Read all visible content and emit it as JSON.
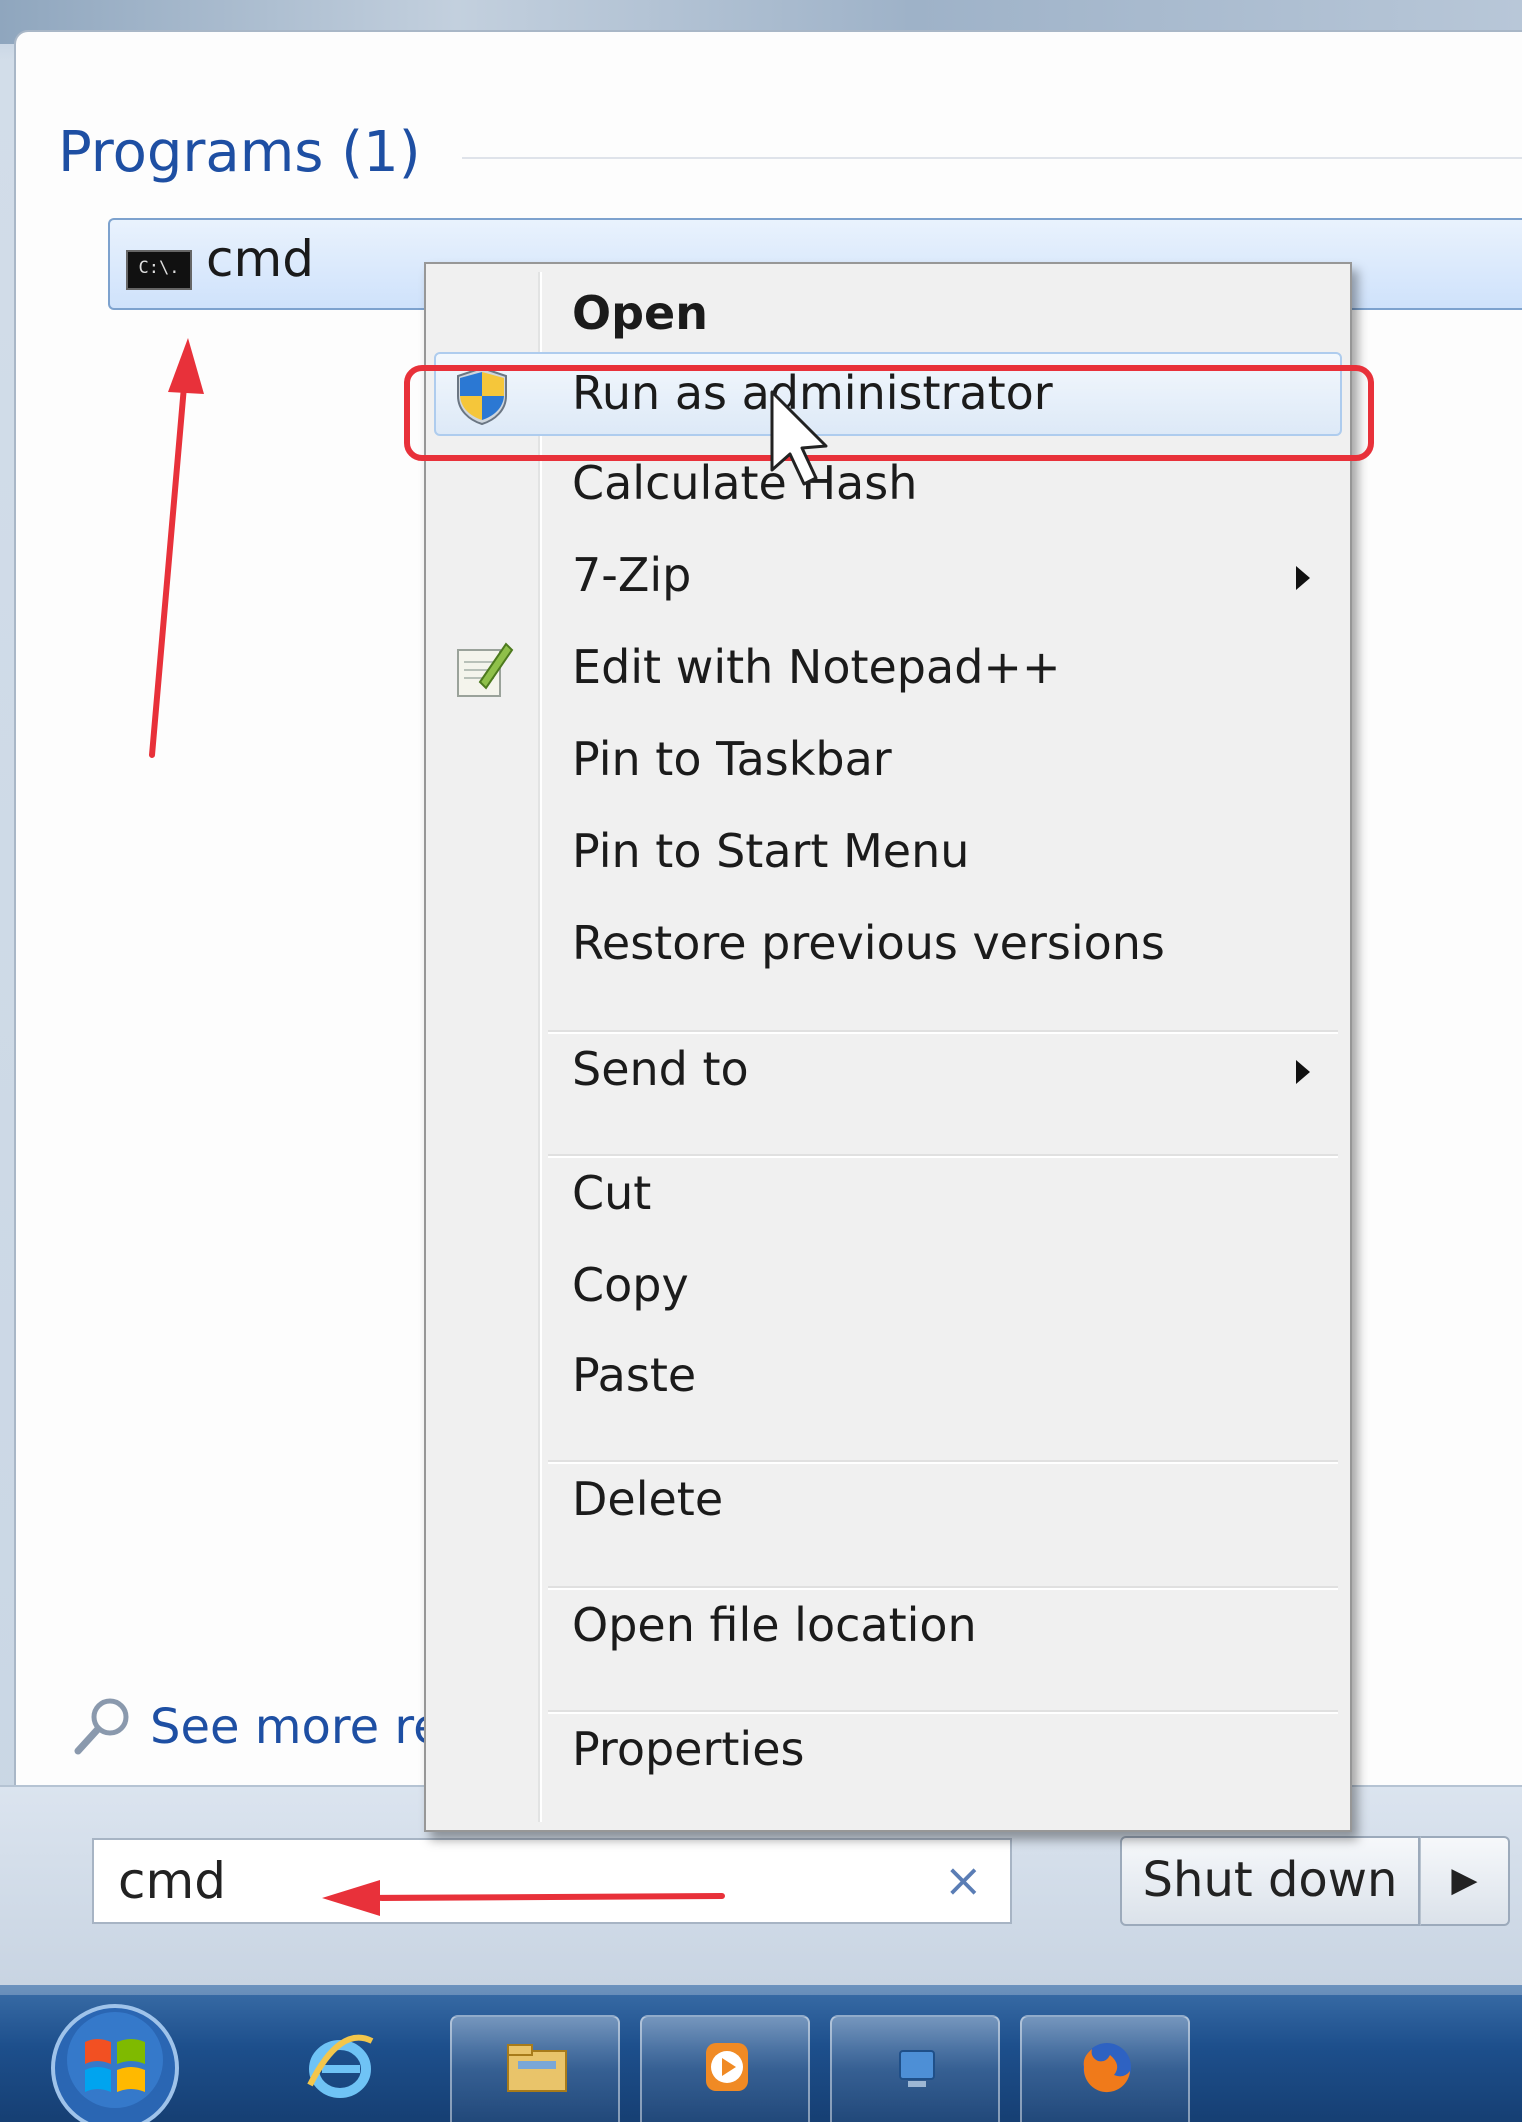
{
  "programs": {
    "heading": "Programs (1)",
    "result": {
      "label": "cmd",
      "icon": "cmd-console-icon",
      "icon_text": "C:\\."
    }
  },
  "see_more": {
    "label": "See more res",
    "icon": "search-magnifier-icon"
  },
  "search": {
    "value": "cmd",
    "clear_icon": "×"
  },
  "shutdown": {
    "label": "Shut down",
    "arrow": "▶"
  },
  "context_menu": {
    "items": [
      {
        "label": "Open",
        "bold": true,
        "icon": "",
        "submenu": false
      },
      {
        "label": "Run as administrator",
        "bold": false,
        "icon": "uac-shield-icon",
        "submenu": false,
        "hovered": true
      },
      {
        "label": "Calculate Hash",
        "bold": false,
        "icon": "",
        "submenu": false
      },
      {
        "label": "7-Zip",
        "bold": false,
        "icon": "",
        "submenu": true
      },
      {
        "label": "Edit with Notepad++",
        "bold": false,
        "icon": "notepad-plus-plus-icon",
        "submenu": false
      },
      {
        "label": "Pin to Taskbar",
        "bold": false,
        "icon": "",
        "submenu": false
      },
      {
        "label": "Pin to Start Menu",
        "bold": false,
        "icon": "",
        "submenu": false
      },
      {
        "label": "Restore previous versions",
        "bold": false,
        "icon": "",
        "submenu": false
      },
      {
        "label": "Send to",
        "bold": false,
        "icon": "",
        "submenu": true
      },
      {
        "label": "Cut",
        "bold": false,
        "icon": "",
        "submenu": false
      },
      {
        "label": "Copy",
        "bold": false,
        "icon": "",
        "submenu": false
      },
      {
        "label": "Paste",
        "bold": false,
        "icon": "",
        "submenu": false
      },
      {
        "label": "Delete",
        "bold": false,
        "icon": "",
        "submenu": false
      },
      {
        "label": "Open file location",
        "bold": false,
        "icon": "",
        "submenu": false
      },
      {
        "label": "Properties",
        "bold": false,
        "icon": "",
        "submenu": false
      }
    ]
  },
  "taskbar": {
    "icons": [
      "windows-start-orb-icon",
      "internet-explorer-icon",
      "file-explorer-icon",
      "media-player-icon",
      "network-icon",
      "firefox-icon"
    ]
  },
  "colors": {
    "annotation_red": "#e8313a",
    "link_blue": "#1e4fa3",
    "taskbar_blue": "#1d4f8c",
    "menu_hover": "#dde9f7"
  }
}
